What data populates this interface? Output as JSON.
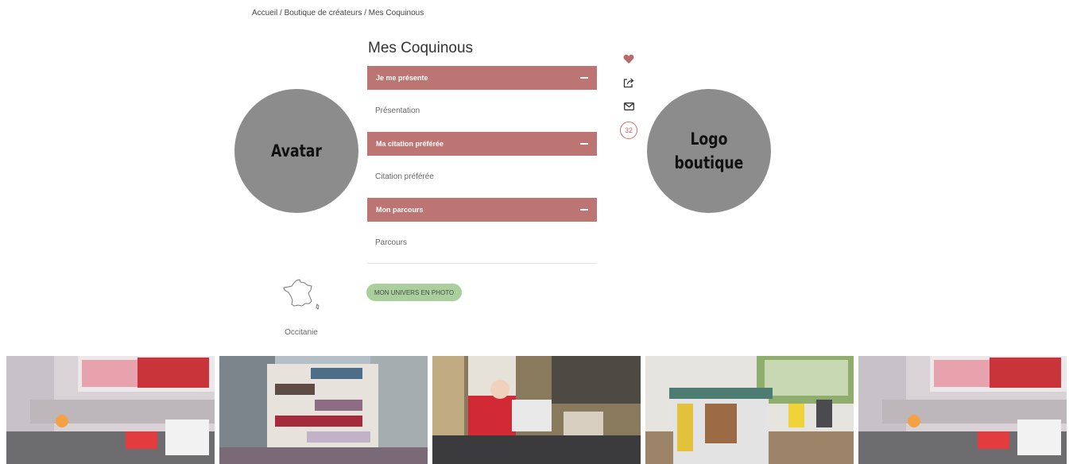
{
  "breadcrumb": {
    "text": "Accueil / Boutique de créateurs / Mes Coquinous"
  },
  "shop": {
    "title": "Mes Coquinous"
  },
  "avatar": {
    "label": "Avatar"
  },
  "logo": {
    "line1": "Logo",
    "line2": "boutique"
  },
  "accordion": [
    {
      "header": "Je me présente",
      "body": "Présentation"
    },
    {
      "header": "Ma citation préférée",
      "body": "Citation préférée"
    },
    {
      "header": "Mon parcours",
      "body": "Parcours"
    }
  ],
  "actions": {
    "count": "32"
  },
  "univers_button": {
    "label": "MON UNIVERS EN PHOTO"
  },
  "region": {
    "label": "Occitanie"
  },
  "icons": {
    "favorite": "heart-icon",
    "share": "share-icon",
    "contact": "envelope-icon",
    "region": "france-map-icon"
  },
  "colors": {
    "accent": "#bd7573",
    "button_green": "#a9cf9d",
    "placeholder_gray": "#8c8c8c"
  }
}
